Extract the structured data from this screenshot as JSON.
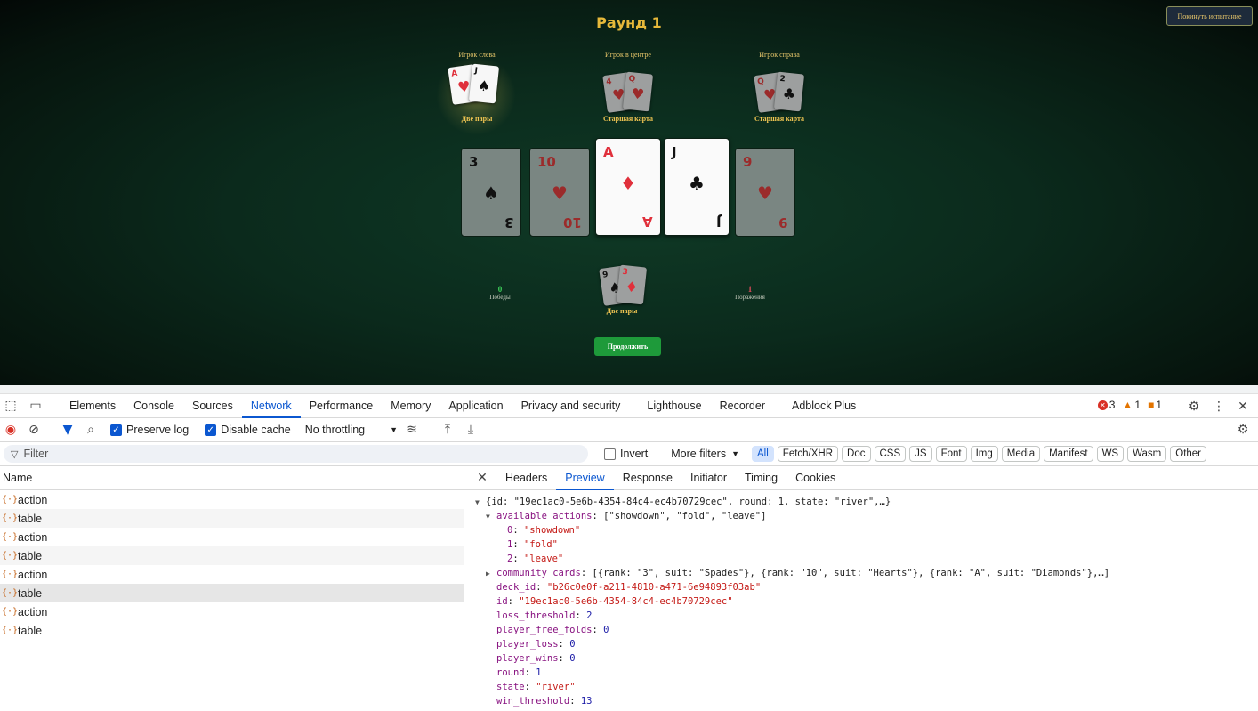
{
  "game": {
    "round_title": "Раунд 1",
    "leave_button": "Покинуть испытание",
    "players": [
      {
        "label": "Игрок слева",
        "hand": "Две пары",
        "cards": [
          {
            "rank": "A",
            "suit": "♥",
            "color": "red"
          },
          {
            "rank": "J",
            "suit": "♠",
            "color": "black"
          }
        ]
      },
      {
        "label": "Игрок в центре",
        "hand": "Старшая карта",
        "cards": [
          {
            "rank": "4",
            "suit": "♥",
            "color": "red"
          },
          {
            "rank": "Q",
            "suit": "♥",
            "color": "red"
          }
        ]
      },
      {
        "label": "Игрок справа",
        "hand": "Старшая карта",
        "cards": [
          {
            "rank": "Q",
            "suit": "♥",
            "color": "red"
          },
          {
            "rank": "2",
            "suit": "♣",
            "color": "black"
          }
        ]
      }
    ],
    "community_cards": [
      {
        "rank": "3",
        "suit": "♠",
        "highlight": false
      },
      {
        "rank": "10",
        "suit": "♥",
        "highlight": false
      },
      {
        "rank": "A",
        "suit": "♦",
        "highlight": true
      },
      {
        "rank": "J",
        "suit": "♣",
        "highlight": true
      },
      {
        "rank": "9",
        "suit": "♥",
        "highlight": false
      }
    ],
    "player_hand": {
      "hand": "Две пары",
      "cards": [
        {
          "rank": "9",
          "suit": "♠"
        },
        {
          "rank": "3",
          "suit": "♦"
        }
      ]
    },
    "wins": {
      "value": "0",
      "label": "Победы"
    },
    "losses": {
      "value": "1",
      "label": "Поражения"
    },
    "continue_button": "Продолжить"
  },
  "devtools": {
    "tabs": [
      "Elements",
      "Console",
      "Sources",
      "Network",
      "Performance",
      "Memory",
      "Application",
      "Privacy and security",
      "Lighthouse",
      "Recorder",
      "Adblock Plus"
    ],
    "active_tab": "Network",
    "errors": "3",
    "warnings": "1",
    "issues": "1",
    "preserve_log": "Preserve log",
    "disable_cache": "Disable cache",
    "throttling": "No throttling",
    "filter_placeholder": "Filter",
    "invert": "Invert",
    "more_filters": "More filters",
    "type_filters": [
      "All",
      "Fetch/XHR",
      "Doc",
      "CSS",
      "JS",
      "Font",
      "Img",
      "Media",
      "Manifest",
      "WS",
      "Wasm",
      "Other"
    ],
    "name_header": "Name",
    "requests": [
      "action",
      "table",
      "action",
      "table",
      "action",
      "table",
      "action",
      "table"
    ],
    "detail_tabs": [
      "Headers",
      "Preview",
      "Response",
      "Initiator",
      "Timing",
      "Cookies"
    ],
    "active_detail_tab": "Preview",
    "preview": {
      "root": "{id: \"19ec1ac0-5e6b-4354-84c4-ec4b70729cec\", round: 1, state: \"river\",…}",
      "available_actions_key": "available_actions",
      "available_actions_summary": "[\"showdown\", \"fold\", \"leave\"]",
      "available_actions": [
        {
          "idx": "0",
          "val": "\"showdown\""
        },
        {
          "idx": "1",
          "val": "\"fold\""
        },
        {
          "idx": "2",
          "val": "\"leave\""
        }
      ],
      "community_cards_key": "community_cards",
      "community_cards_summary": "[{rank: \"3\", suit: \"Spades\"}, {rank: \"10\", suit: \"Hearts\"}, {rank: \"A\", suit: \"Diamonds\"},…]",
      "fields": [
        {
          "k": "deck_id",
          "v": "\"b26c0e0f-a211-4810-a471-6e94893f03ab\"",
          "t": "str"
        },
        {
          "k": "id",
          "v": "\"19ec1ac0-5e6b-4354-84c4-ec4b70729cec\"",
          "t": "str"
        },
        {
          "k": "loss_threshold",
          "v": "2",
          "t": "num"
        },
        {
          "k": "player_free_folds",
          "v": "0",
          "t": "num"
        },
        {
          "k": "player_loss",
          "v": "0",
          "t": "num"
        },
        {
          "k": "player_wins",
          "v": "0",
          "t": "num"
        },
        {
          "k": "round",
          "v": "1",
          "t": "num"
        },
        {
          "k": "state",
          "v": "\"river\"",
          "t": "str"
        },
        {
          "k": "win_threshold",
          "v": "13",
          "t": "num"
        }
      ]
    }
  }
}
